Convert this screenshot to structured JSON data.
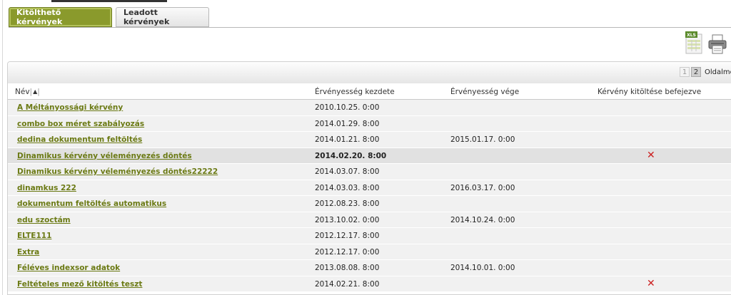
{
  "tabs": [
    {
      "label": "Kitölthető kérvények",
      "active": true
    },
    {
      "label": "Leadott kérvények",
      "active": false
    }
  ],
  "toolbar": {
    "xls_label": "XLS",
    "icons": [
      "xls-export-icon",
      "print-icon"
    ]
  },
  "pager": {
    "pages": [
      "1",
      "2"
    ],
    "current": "2",
    "label": "Oldalme"
  },
  "columns": {
    "name": "Név",
    "start": "Érvényesség kezdete",
    "end": "Érvényesség vége",
    "done": "Kérvény kitöltése befejezve"
  },
  "rows": [
    {
      "name": "A Méltányossági kérvény",
      "start": "2010.10.25. 0:00",
      "end": "",
      "done": ""
    },
    {
      "name": "combo box méret szabályozás",
      "start": "2014.01.29. 8:00",
      "end": "",
      "done": ""
    },
    {
      "name": "dedina dokumentum feltöltés",
      "start": "2014.01.21. 8:00",
      "end": "2015.01.17. 0:00",
      "done": ""
    },
    {
      "name": "Dinamikus kérvény véleményezés döntés",
      "start": "2014.02.20. 8:00",
      "end": "",
      "done": "✕"
    },
    {
      "name": "Dinamikus kérvény véleményezés döntés22222",
      "start": "2014.03.07. 8:00",
      "end": "",
      "done": ""
    },
    {
      "name": "dinamkus 222",
      "start": "2014.03.03. 8:00",
      "end": "2016.03.17. 0:00",
      "done": ""
    },
    {
      "name": "dokumentum feltöltés automatikus",
      "start": "2012.08.23. 8:00",
      "end": "",
      "done": ""
    },
    {
      "name": "edu szoctám",
      "start": "2013.10.02. 0:00",
      "end": "2014.10.24. 0:00",
      "done": ""
    },
    {
      "name": "ELTE111",
      "start": "2012.12.17. 8:00",
      "end": "",
      "done": ""
    },
    {
      "name": "Extra",
      "start": "2012.12.17. 0:00",
      "end": "",
      "done": ""
    },
    {
      "name": "Féléves indexsor adatok",
      "start": "2013.08.08. 8:00",
      "end": "2014.10.01. 0:00",
      "done": ""
    },
    {
      "name": "Feltételes mező kitöltés teszt",
      "start": "2014.02.21. 8:00",
      "end": "",
      "done": "✕"
    }
  ],
  "colors": {
    "accent": "#8a9a2c",
    "link": "#6b7a14",
    "cross": "#cc2020"
  }
}
